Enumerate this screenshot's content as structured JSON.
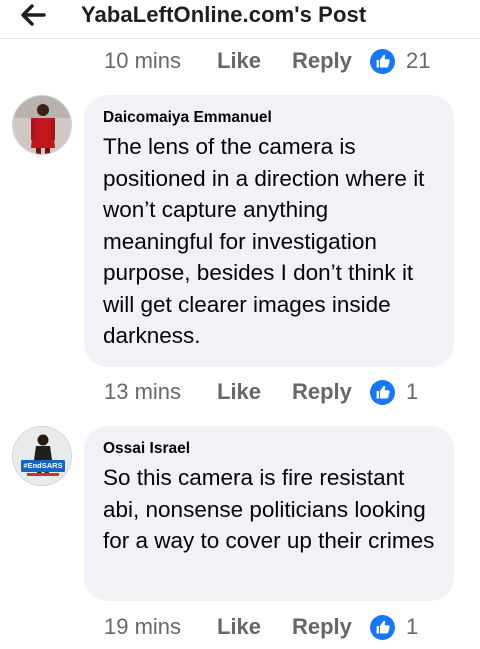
{
  "header": {
    "title": "YabaLeftOnline.com's Post",
    "back_icon": "arrow-left-icon"
  },
  "top_action_row": {
    "time": "10 mins",
    "like_label": "Like",
    "reply_label": "Reply",
    "reaction_icon": "like-reaction-icon",
    "reaction_count": "21"
  },
  "comments": [
    {
      "author": "Daicomaiya Emmanuel",
      "text": "The lens of the camera is positioned in a direction where it won’t capture anything meaningful for investigation purpose, besides I don’t think it will get clearer images inside darkness.",
      "time": "13 mins",
      "like_label": "Like",
      "reply_label": "Reply",
      "reaction_icon": "like-reaction-icon",
      "reaction_count": "1"
    },
    {
      "author": "Ossai Israel",
      "text": "So this camera is fire resistant abi, nonsense politicians looking for a way to cover up their crimes",
      "time": "19 mins",
      "like_label": "Like",
      "reply_label": "Reply",
      "reaction_icon": "like-reaction-icon",
      "reaction_count": "1",
      "avatar_badge": "#EndSARS"
    }
  ],
  "colors": {
    "muted_text": "#65676b",
    "bubble_bg": "#f0f2f5",
    "like_blue": "#1877f2"
  }
}
